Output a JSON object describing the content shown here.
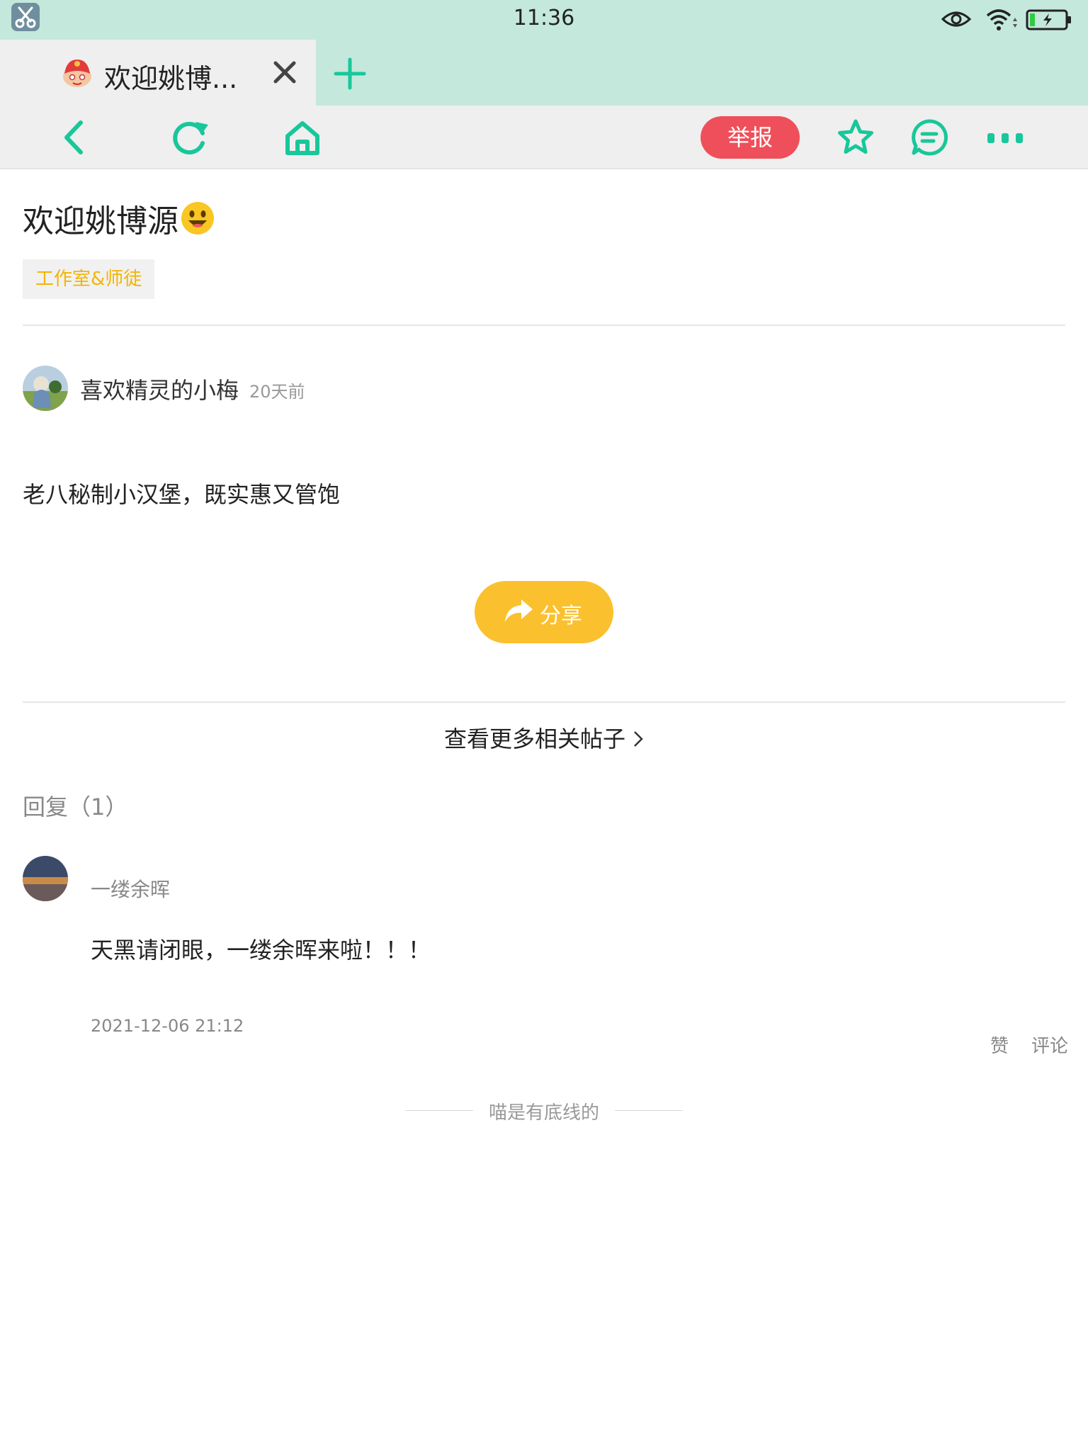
{
  "status_bar": {
    "time": "11:36"
  },
  "browser": {
    "tab_title": "欢迎姚博...",
    "report_label": "举报",
    "accent_color": "#18c79a"
  },
  "post": {
    "title": "欢迎姚博源",
    "tag": "工作室&师徒",
    "author": "喜欢精灵的小梅",
    "time_ago": "20天前",
    "body": "老八秘制小汉堡，既实惠又管饱",
    "share_label": "分享",
    "more_link": "查看更多相关帖子"
  },
  "replies": {
    "heading": "回复（1）",
    "items": [
      {
        "name": "一缕余晖",
        "body": "天黑请闭眼，一缕余晖来啦！！！",
        "time": "2021-12-06 21:12",
        "like_label": "赞",
        "comment_label": "评论"
      }
    ]
  },
  "footer": {
    "end_text": "喵是有底线的"
  }
}
